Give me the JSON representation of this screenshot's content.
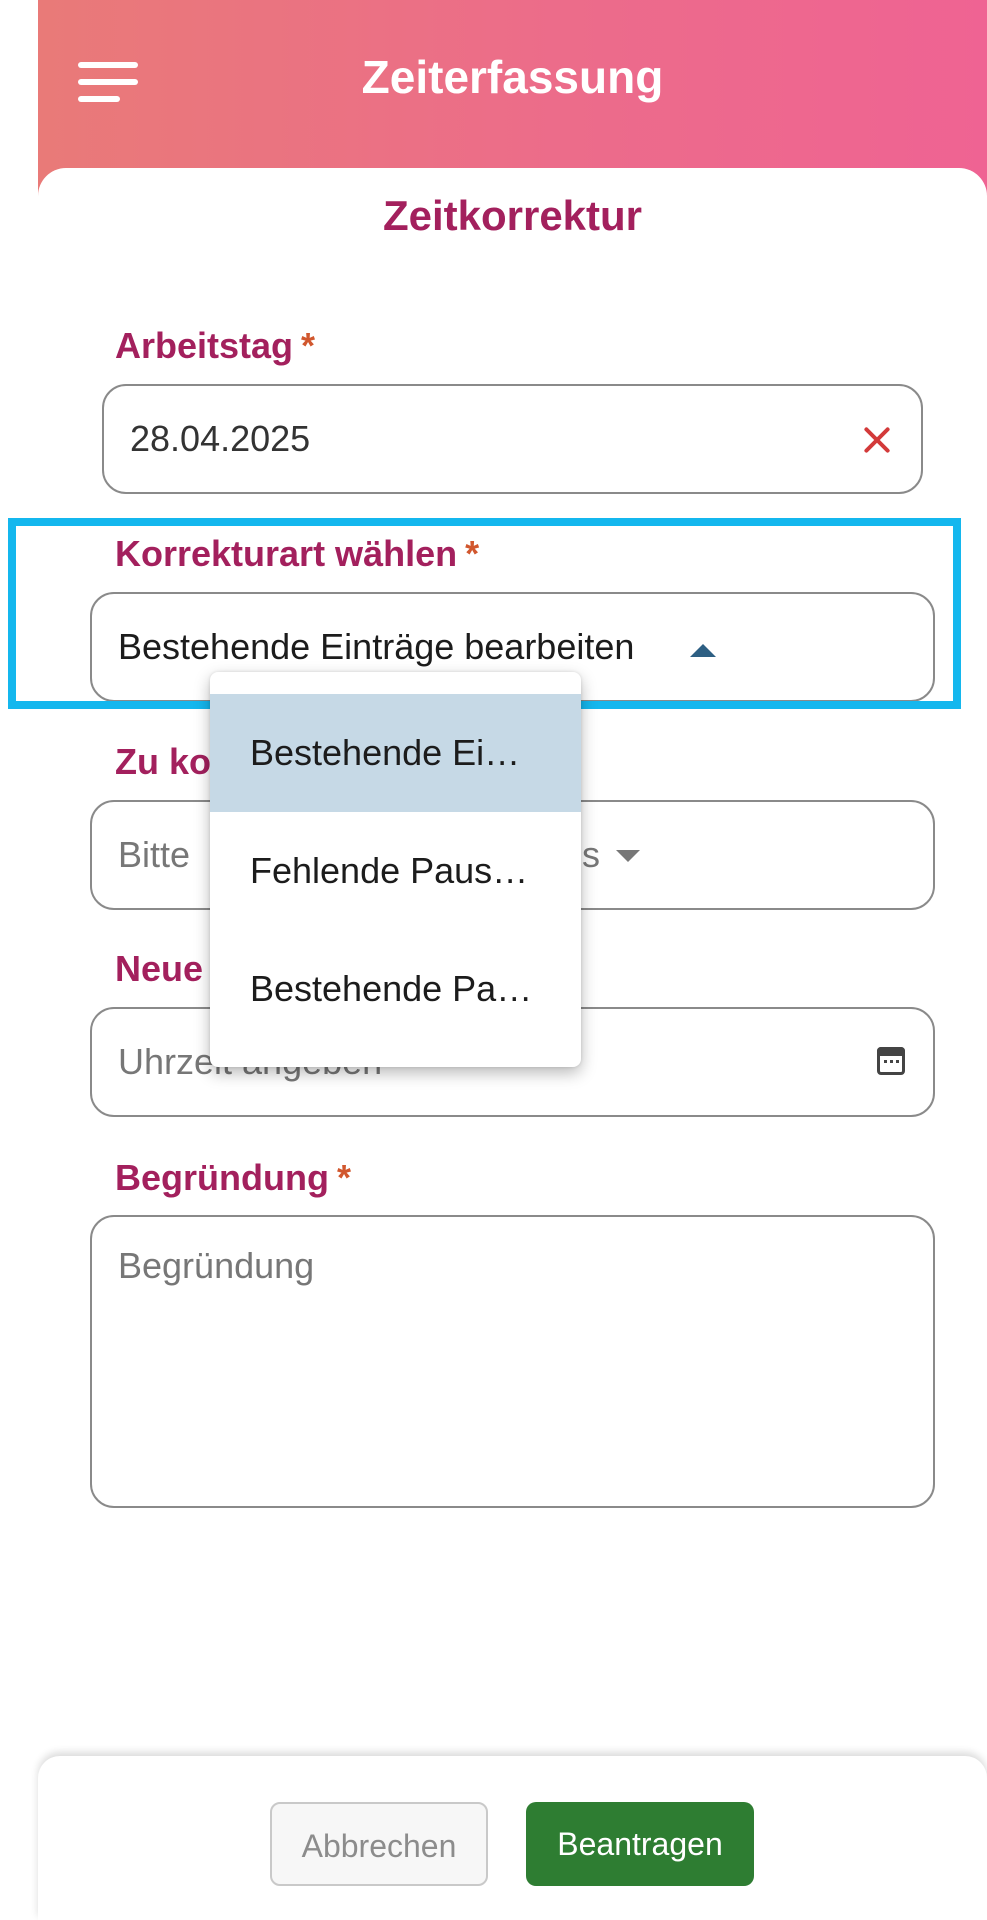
{
  "header": {
    "title": "Zeiterfassung"
  },
  "page": {
    "title": "Zeitkorrektur"
  },
  "form": {
    "required_marker": "*",
    "workday": {
      "label": "Arbeitstag",
      "value": "28.04.2025"
    },
    "correction_type": {
      "label": "Korrekturart wählen",
      "value": "Bestehende Einträge bearbeiten",
      "options": [
        "Bestehende Ei…",
        "Fehlende Paus…",
        "Bestehende Pa…"
      ]
    },
    "entry": {
      "label_visible": "Zu ko",
      "placeholder_start": "Bitte ",
      "placeholder_end": "s"
    },
    "new_time": {
      "label_visible": "Neue",
      "placeholder": "Uhrzeit angeben"
    },
    "reason": {
      "label": "Begründung",
      "placeholder": "Begründung"
    }
  },
  "footer": {
    "cancel_label": "Abbrechen",
    "submit_label": "Beantragen"
  },
  "colors": {
    "header_gradient_start": "#e97a78",
    "header_gradient_end": "#ef6393",
    "label": "#a3205d",
    "required": "#d1572e",
    "highlight_border": "#14b7ee",
    "selected_option": "#c6d9e6",
    "submit_button": "#2e7d32"
  },
  "icons": [
    "menu-icon",
    "clear-icon",
    "caret-up-icon",
    "caret-down-icon",
    "calendar-icon"
  ]
}
